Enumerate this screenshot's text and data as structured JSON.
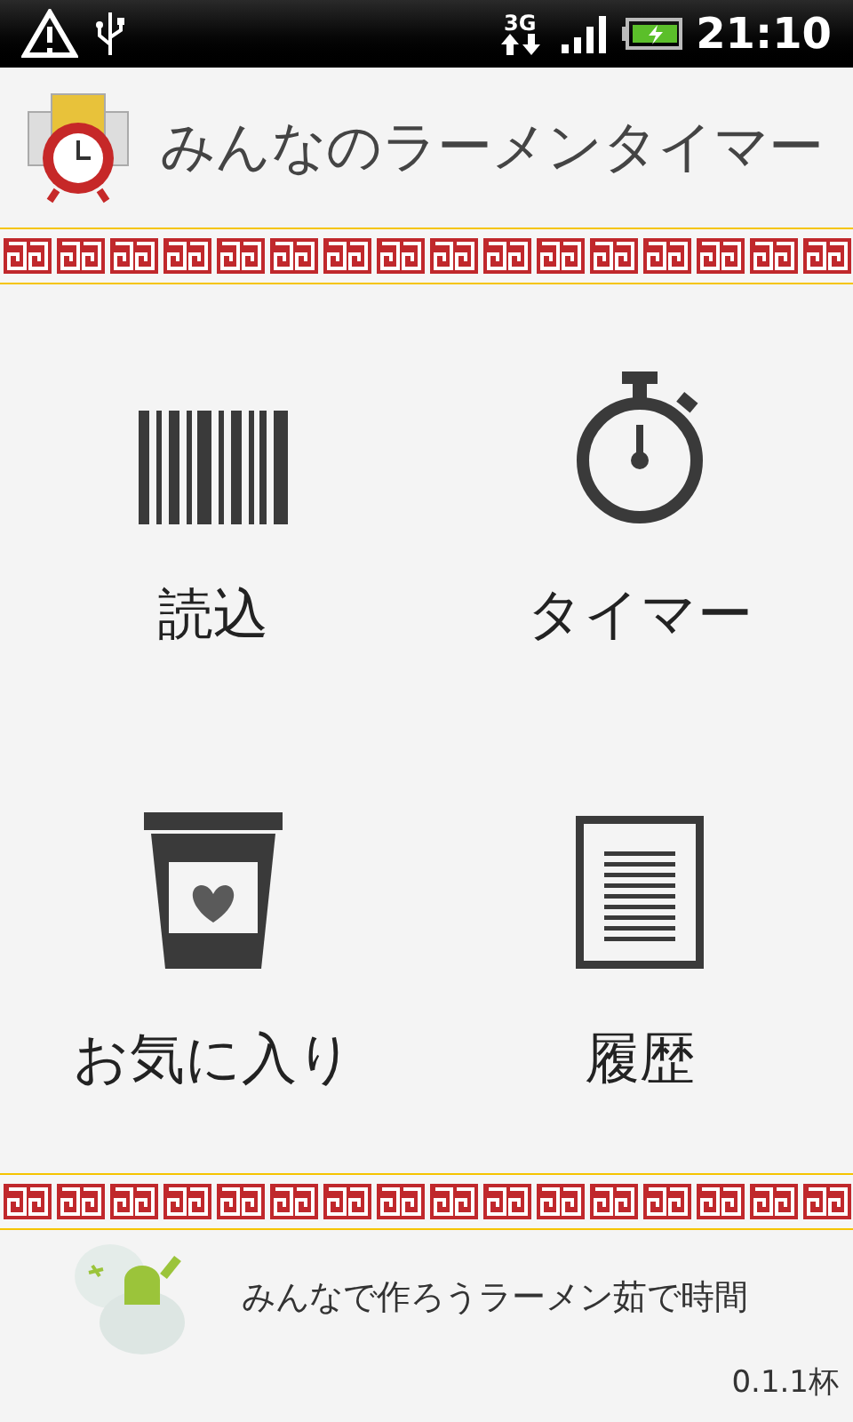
{
  "status_bar": {
    "time": "21:10",
    "network": "3G"
  },
  "header": {
    "title": "みんなのラーメンタイマー"
  },
  "menu": [
    {
      "kind": "barcode",
      "label": "読込"
    },
    {
      "kind": "stopwatch",
      "label": "タイマー"
    },
    {
      "kind": "cup",
      "label": "お気に入り"
    },
    {
      "kind": "document",
      "label": "履歴"
    }
  ],
  "footer": {
    "tagline": "みんなで作ろうラーメン茹で時間",
    "version": "0.1.1杯"
  }
}
